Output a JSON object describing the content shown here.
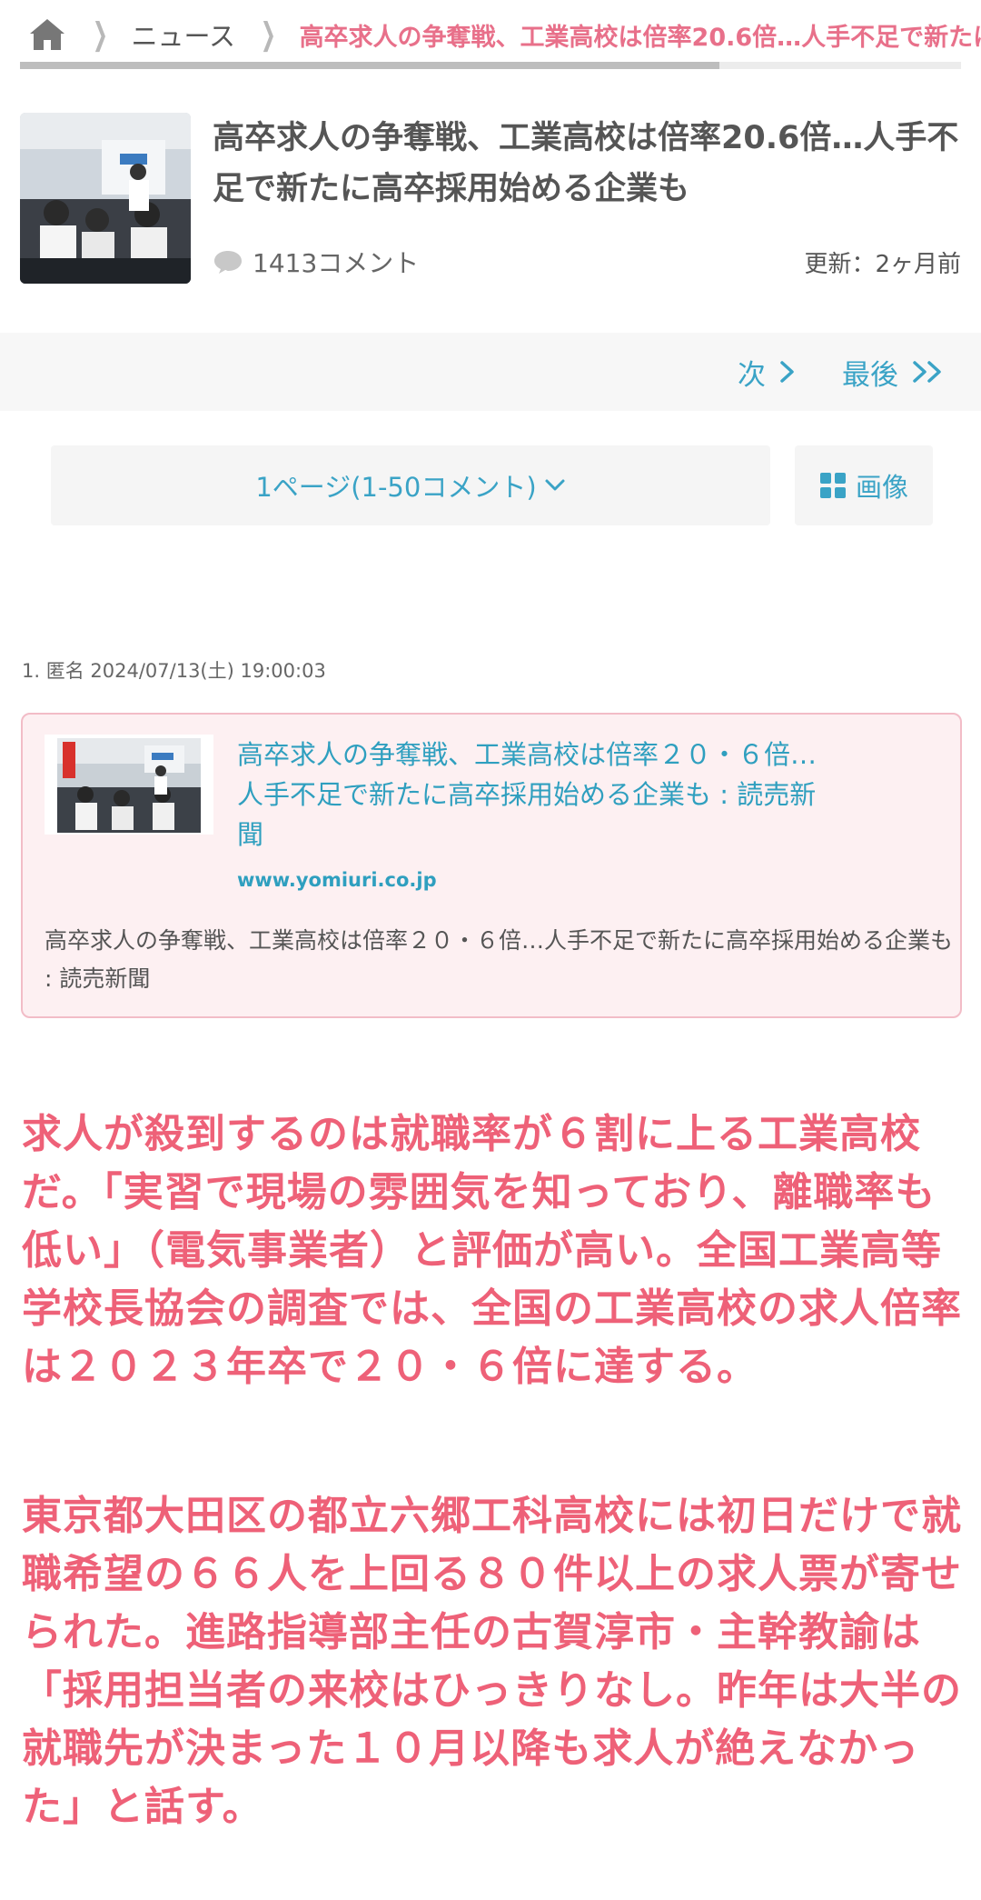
{
  "breadcrumb": {
    "items": [
      "ニュース"
    ],
    "current": "高卒求人の争奪戦、工業高校は倍率20.6倍…人手不足で新たに"
  },
  "article": {
    "title": "高卒求人の争奪戦、工業高校は倍率20.6倍…人手不足で新たに高卒採用始める企業も",
    "comments": "1413コメント",
    "updated": "更新：2ヶ月前"
  },
  "pager": {
    "next": "次",
    "last": "最後"
  },
  "page_select": {
    "label": "1ページ(1-50コメント)"
  },
  "image_button": {
    "label": "画像"
  },
  "comment1": {
    "header": "1. 匿名 2024/07/13(土) 19:00:03",
    "card": {
      "title": "高卒求人の争奪戦、工業高校は倍率２０・６倍…人手不足で新たに高卒採用始める企業も : 読売新聞",
      "domain": "www.yomiuri.co.jp",
      "description": "高卒求人の争奪戦、工業高校は倍率２０・６倍…人手不足で新たに高卒採用始める企業も : 読売新聞"
    },
    "quotes": [
      "求人が殺到するのは就職率が６割に上る工業高校だ。「実習で現場の雰囲気を知っており、離職率も低い」（電気事業者）と評価が高い。全国工業高等学校長協会の調査では、全国の工業高校の求人倍率は２０２３年卒で２０・６倍に達する。",
      "東京都大田区の都立六郷工科高校には初日だけで就職希望の６６人を上回る８０件以上の求人票が寄せられた。進路指導部主任の古賀淳市・主幹教諭は「採用担当者の来校はひっきりなし。昨年は大半の就職先が決まった１０月以降も求人が絶えなかった」と話す。"
    ]
  },
  "colors": {
    "accent_blue": "#3aa3c6",
    "accent_pink": "#ee6178",
    "card_bg": "#fdf0f2",
    "card_border": "#f2bcc7"
  },
  "icons": [
    "home-icon",
    "chevron-right-icon",
    "comment-bubble-icon",
    "chevron-down-icon",
    "double-chevron-right-icon",
    "grid-icon"
  ]
}
